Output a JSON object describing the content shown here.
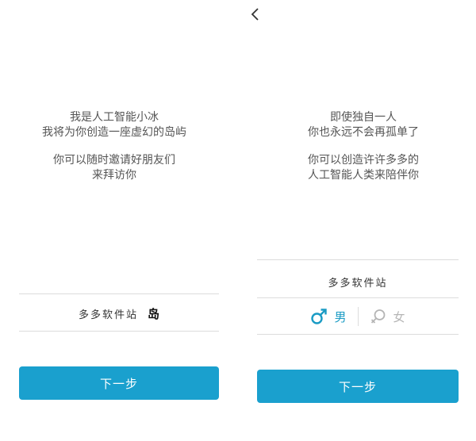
{
  "nav": {
    "back_icon": "chevron-left-icon"
  },
  "left": {
    "intro_para1": [
      "我是人工智能小冰",
      "我将为你创造一座虚幻的岛屿"
    ],
    "intro_para2": [
      "你可以随时邀请好朋友们",
      "来拜访你"
    ],
    "name_text": "多多软件站",
    "island_label": "岛",
    "next_label": "下一步"
  },
  "right": {
    "intro_para1": [
      "即使独自一人",
      "你也永远不会再孤单了"
    ],
    "intro_para2": [
      "你可以创造许许多多的",
      "人工智能人类来陪伴你"
    ],
    "name_text": "多多软件站",
    "male_label": "男",
    "female_label": "女",
    "male_icon": "male-symbol-icon",
    "female_icon": "female-symbol-icon",
    "next_label": "下一步"
  },
  "colors": {
    "accent": "#1aa0ce",
    "male": "#1a9bc4",
    "female_inactive": "#b5b5b5",
    "divider": "#dcdcdc"
  }
}
